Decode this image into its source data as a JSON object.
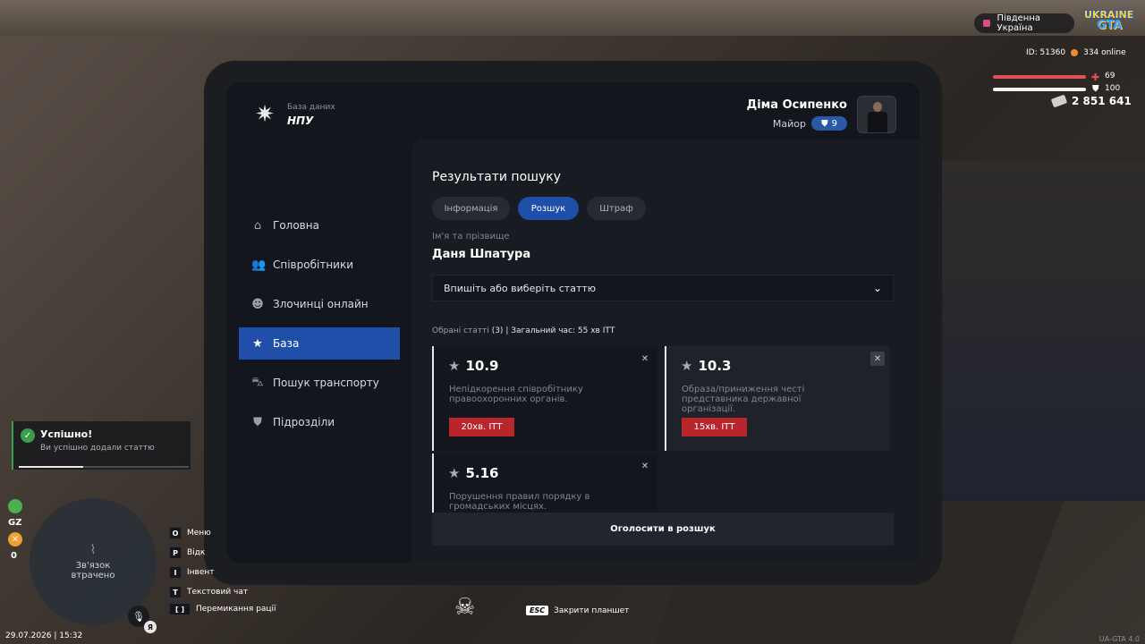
{
  "hud": {
    "server_name": "Південна Україна",
    "logo_line1": "UKRAINE",
    "logo_line2": "GTA",
    "player_id": "ID: 51360",
    "online": "334 online",
    "health": "69",
    "armor": "100",
    "money": "2 851 641",
    "colors": {
      "health": "#e0505a",
      "armor": "#f2f2f2",
      "accent": "#1f4fa8",
      "penalty": "#b8262c",
      "success": "#3a9f4c"
    }
  },
  "tablet": {
    "brand_sub": "База даних",
    "brand_title": "НПУ",
    "user": {
      "name": "Діма Осипенко",
      "rank": "Майор",
      "level": "9"
    },
    "nav": [
      {
        "label": "Головна",
        "icon": "home-icon"
      },
      {
        "label": "Співробітники",
        "icon": "users-icon"
      },
      {
        "label": "Злочинці онлайн",
        "icon": "criminal-icon"
      },
      {
        "label": "База",
        "icon": "star-icon",
        "active": true
      },
      {
        "label": "Пошук транспорту",
        "icon": "car-icon"
      },
      {
        "label": "Підрозділи",
        "icon": "shield-icon"
      }
    ],
    "results_title": "Результати пошуку",
    "tabs": [
      {
        "label": "Інформація"
      },
      {
        "label": "Розшук",
        "active": true
      },
      {
        "label": "Штраф"
      }
    ],
    "name_label": "Ім'я та прізвище",
    "name_value": "Даня Шпатура",
    "article_select": {
      "placeholder": "Впишіть або виберіть статтю"
    },
    "summary": {
      "prefix": "Обрані статті",
      "count": "(3)",
      "suffix": "| Загальний час: 55 хв ІТТ"
    },
    "articles": [
      {
        "number": "10.9",
        "description": "Непідкорення співробітнику правоохоронних органів.",
        "penalty": "20хв. ІТТ"
      },
      {
        "number": "10.3",
        "description": "Образа/приниження честі представника державної організації.",
        "penalty": "15хв. ІТТ"
      },
      {
        "number": "5.16",
        "description": "Порушення правил порядку в громадських місцях."
      }
    ],
    "announce_button": "Оголосити в розшук"
  },
  "notification": {
    "title": "Успішно!",
    "text": "Ви успішно додали статтю",
    "progress": 0.38
  },
  "minimap": {
    "gz": "GZ",
    "wanted": "0",
    "status": "Зв'язок втрачено",
    "voice_key": "Я"
  },
  "keybinds": [
    {
      "key": "O",
      "label": "Меню"
    },
    {
      "key": "P",
      "label": "Відк"
    },
    {
      "key": "I",
      "label": "Інвент"
    },
    {
      "key": "T",
      "label": "Текстовий чат"
    },
    {
      "key": "[ ]",
      "label": "Перемикання рації"
    }
  ],
  "esc_hint": {
    "key": "ESC",
    "label": "Закрити планшет"
  },
  "datetime": "29.07.2026 | 15:32",
  "version": "UA-GTA 4.0"
}
